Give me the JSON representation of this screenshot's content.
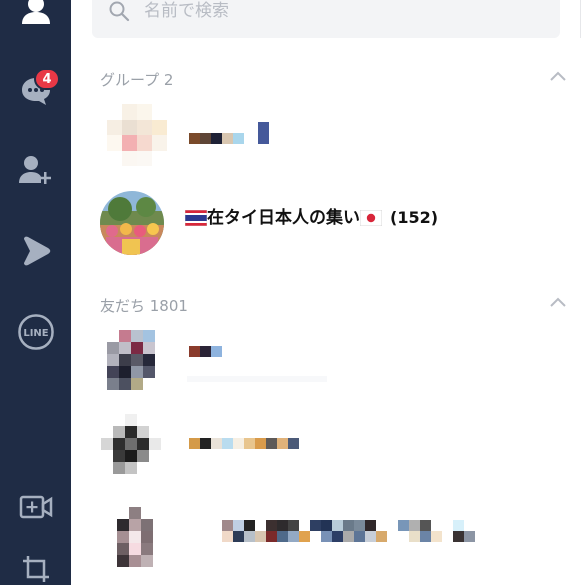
{
  "sidebar": {
    "items": [
      {
        "name": "friends",
        "icon": "person-icon"
      },
      {
        "name": "chats",
        "icon": "chat-bubble-icon",
        "badge": "4"
      },
      {
        "name": "add-friend",
        "icon": "add-person-icon"
      },
      {
        "name": "openchat",
        "icon": "play-arrow-icon"
      },
      {
        "name": "line",
        "icon": "line-logo-icon",
        "label": "LINE"
      },
      {
        "name": "video-call",
        "icon": "video-plus-icon"
      },
      {
        "name": "screenshot",
        "icon": "crop-icon"
      }
    ]
  },
  "search": {
    "placeholder": "名前で検索"
  },
  "groups_section": {
    "title": "グループ 2"
  },
  "group_row": {
    "name": "在タイ日本人の集い",
    "count": "(152)"
  },
  "friends_section": {
    "title": "友だち 1801"
  },
  "colors": {
    "sidebar_bg": "#1f2c45",
    "badge": "#e83846",
    "section_text": "#9aa0a8"
  }
}
